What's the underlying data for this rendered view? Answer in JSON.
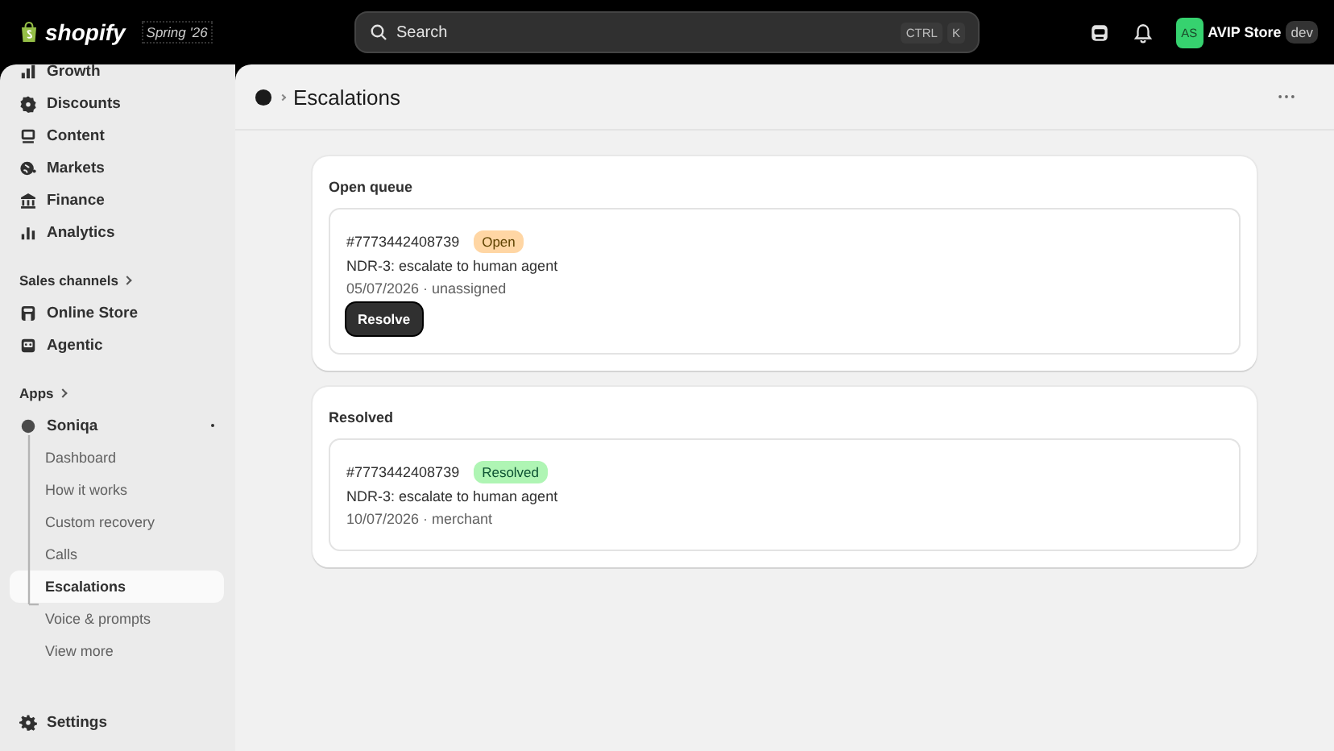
{
  "topbar": {
    "brand": "shopify",
    "edition": "Spring '26",
    "search": {
      "placeholder": "Search",
      "shortcut": [
        "CTRL",
        "K"
      ]
    },
    "store": {
      "initials": "AS",
      "name": "AVIP Store",
      "tag": "dev"
    }
  },
  "sidebar": {
    "groups": [
      {
        "items": [
          {
            "label": "Growth",
            "kind": "growth",
            "selected": false
          },
          {
            "label": "Discounts",
            "kind": "discount",
            "selected": false
          },
          {
            "label": "Content",
            "kind": "content",
            "selected": false
          },
          {
            "label": "Markets",
            "kind": "globe",
            "selected": false
          },
          {
            "label": "Finance",
            "kind": "bank",
            "selected": false
          },
          {
            "label": "Analytics",
            "kind": "chart",
            "selected": false
          }
        ]
      },
      {
        "heading": "Sales channels",
        "items": [
          {
            "label": "Online Store",
            "kind": "store",
            "selected": false
          },
          {
            "label": "Agentic",
            "kind": "robot",
            "selected": false
          }
        ]
      },
      {
        "heading": "Apps",
        "items": [
          {
            "label": "Soniqa",
            "kind": "app",
            "selected": false,
            "children": [
              {
                "label": "Dashboard",
                "selected": false
              },
              {
                "label": "How it works",
                "selected": false
              },
              {
                "label": "Custom recovery",
                "selected": false
              },
              {
                "label": "Calls",
                "selected": false
              },
              {
                "label": "Escalations",
                "selected": true
              },
              {
                "label": "Voice & prompts",
                "selected": false
              },
              {
                "label": "View more",
                "selected": false
              }
            ]
          }
        ]
      }
    ],
    "footer": {
      "label": "Settings"
    }
  },
  "page": {
    "title": "Escalations",
    "sections": [
      {
        "title": "Open queue",
        "items": [
          {
            "id": "#7773442408739",
            "status": "Open",
            "kind": "open",
            "title": "NDR-3: escalate to human agent",
            "meta": "05/07/2026 · unassigned",
            "action": "Resolve"
          }
        ]
      },
      {
        "title": "Resolved",
        "items": [
          {
            "id": "#7773442408739",
            "status": "Resolved",
            "kind": "resolved",
            "title": "NDR-3: escalate to human agent",
            "meta": "10/07/2026 · merchant"
          }
        ]
      }
    ]
  }
}
